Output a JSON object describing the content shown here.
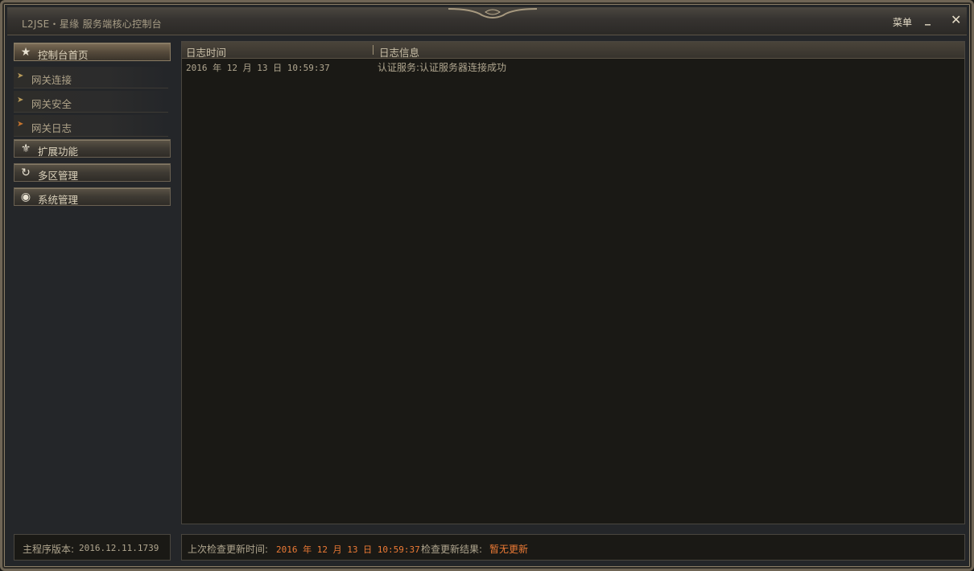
{
  "window": {
    "title": "L2JSE・星缘 服务端核心控制台",
    "menu_label": "菜单",
    "minimize_glyph": "_",
    "close_glyph": "✕"
  },
  "sidebar": {
    "items": [
      {
        "label": "控制台首页",
        "icon": "star-icon",
        "kind": "main",
        "active": true
      },
      {
        "label": "网关连接",
        "icon": "arrow-icon",
        "kind": "sub"
      },
      {
        "label": "网关安全",
        "icon": "arrow-icon",
        "kind": "sub"
      },
      {
        "label": "网关日志",
        "icon": "arrow-icon",
        "kind": "sub"
      },
      {
        "label": "扩展功能",
        "icon": "fleur-de-lis-icon",
        "kind": "main"
      },
      {
        "label": "多区管理",
        "icon": "refresh-icon",
        "kind": "main"
      },
      {
        "label": "系统管理",
        "icon": "eye-icon",
        "kind": "main"
      }
    ]
  },
  "log": {
    "columns": {
      "time": "日志时间",
      "message": "日志信息"
    },
    "rows": [
      {
        "time": "2016 年 12 月 13 日 10:59:37",
        "message": "认证服务:认证服务器连接成功"
      }
    ]
  },
  "footer": {
    "version_label": "主程序版本:",
    "version_value": "2016.12.11.1739",
    "last_check_label": "上次检查更新时间:",
    "last_check_time": "2016 年 12 月 13 日 10:59:37",
    "check_result_label": "检查更新结果:",
    "check_result_value": "暂无更新"
  },
  "colors": {
    "accent_orange": "#ec7a35",
    "text": "#b0a68f",
    "frame": "#6f6555"
  }
}
